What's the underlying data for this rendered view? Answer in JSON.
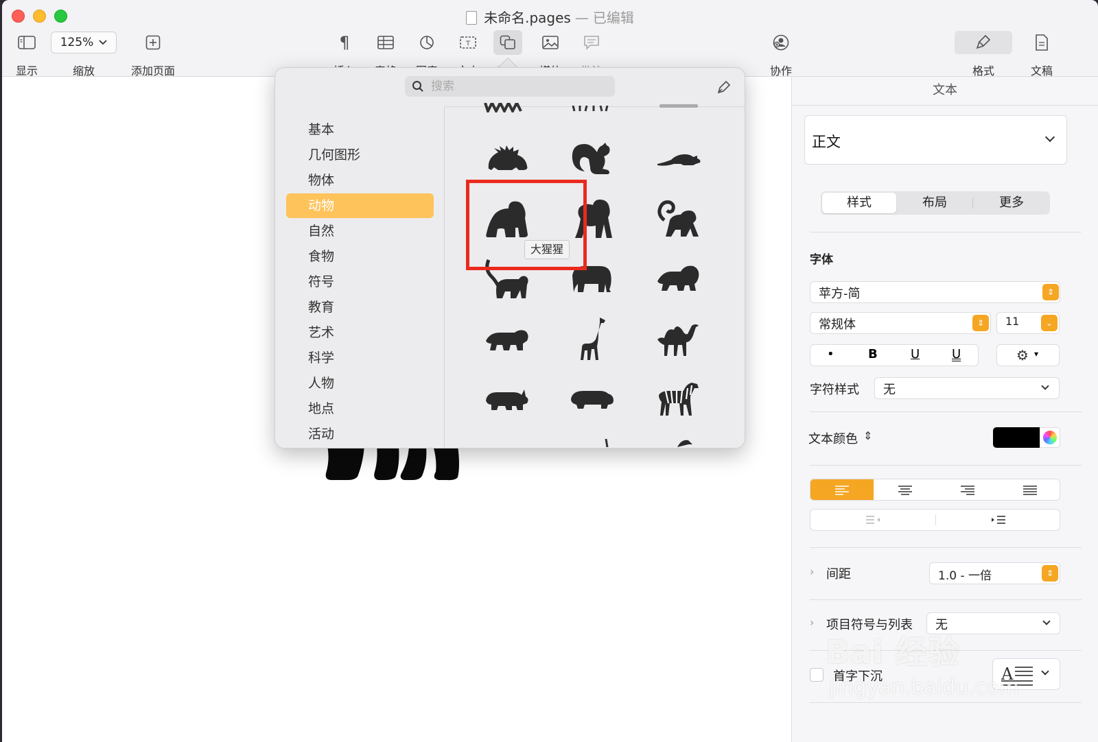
{
  "window": {
    "title": "未命名.pages",
    "separator": "—",
    "status": "已编辑"
  },
  "toolbar": {
    "view": "显示",
    "zoom_value": "125%",
    "zoom": "缩放",
    "add_page": "添加页面",
    "insert": "插入",
    "table": "表格",
    "chart": "图表",
    "text": "文本",
    "shape": "形状",
    "media": "媒体",
    "comment": "批注",
    "collaborate": "协作",
    "format": "格式",
    "document": "文稿"
  },
  "shapes_popup": {
    "search_placeholder": "搜索",
    "categories": [
      "基本",
      "几何图形",
      "物体",
      "动物",
      "自然",
      "食物",
      "符号",
      "教育",
      "艺术",
      "科学",
      "人物",
      "地点",
      "活动"
    ],
    "selected_category": "动物",
    "tooltip": "大猩猩",
    "shapes": [
      "porcupine",
      "squirrel",
      "mouse",
      "gorilla",
      "chimpanzee",
      "monkey",
      "lemur",
      "elephant",
      "lion",
      "tiger",
      "giraffe",
      "camel",
      "rhinoceros",
      "hippopotamus",
      "zebra"
    ]
  },
  "inspector": {
    "title": "文本",
    "paragraph_style": "正文",
    "tabs": [
      "样式",
      "布局",
      "更多"
    ],
    "font_section": "字体",
    "font_family": "苹方-简",
    "font_weight": "常规体",
    "font_size": "11",
    "bold": "B",
    "underline": "U",
    "char_style_label": "字符样式",
    "char_style_value": "无",
    "text_color_label": "文本颜色",
    "text_color": "#000000",
    "spacing_label": "间距",
    "spacing_value": "1.0 - 一倍",
    "bullets_label": "项目符号与列表",
    "bullets_value": "无",
    "drop_cap_label": "首字下沉"
  },
  "watermark": {
    "brand": "Bai 经验",
    "url": "jingyan.baidu.com"
  },
  "colors": {
    "accent": "#f5a623",
    "selected_category": "#fec35a",
    "highlight": "#ea2a1e"
  }
}
